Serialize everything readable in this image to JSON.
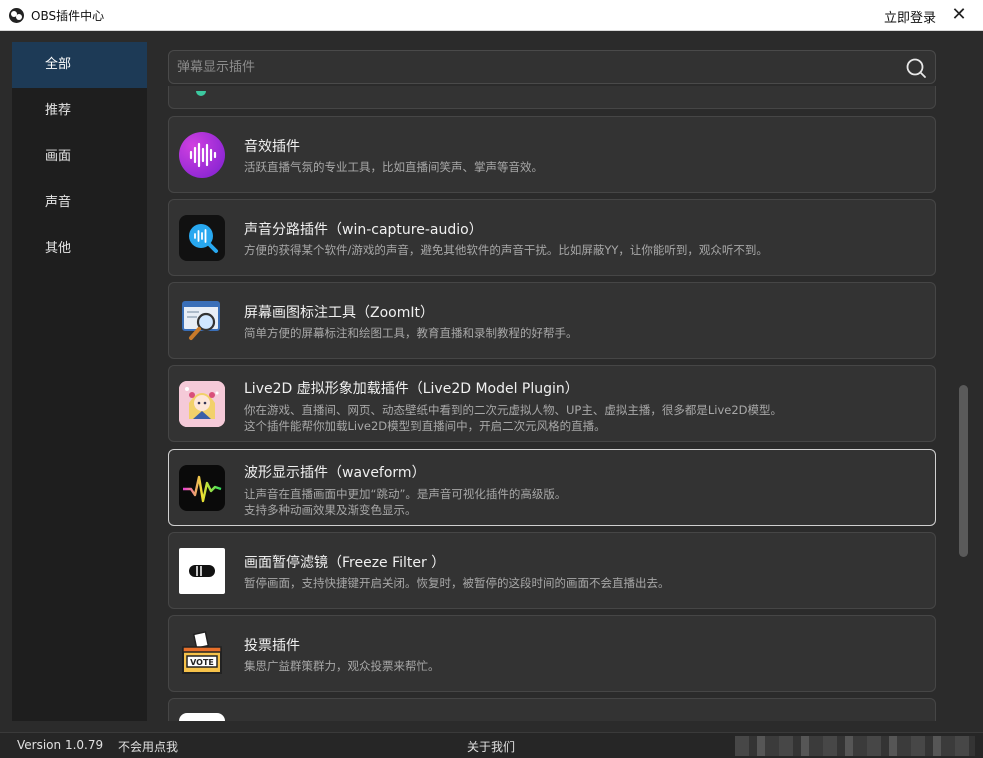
{
  "window": {
    "title": "OBS插件中心",
    "login": "立即登录",
    "close": "✕"
  },
  "sidebar": {
    "items": [
      {
        "label": "全部",
        "active": true
      },
      {
        "label": "推荐"
      },
      {
        "label": "画面"
      },
      {
        "label": "声音"
      },
      {
        "label": "其他"
      }
    ]
  },
  "search": {
    "placeholder": "弹幕显示插件"
  },
  "plugins": [
    {
      "name": "音效插件",
      "desc": [
        "活跃直播气氛的专业工具，比如直播间笑声、掌声等音效。"
      ],
      "icon": "sound-wave-icon"
    },
    {
      "name": "声音分路插件（win-capture-audio）",
      "desc": [
        "方便的获得某个软件/游戏的声音，避免其他软件的声音干扰。比如屏蔽YY，让你能听到，观众听不到。"
      ],
      "icon": "audio-search-icon"
    },
    {
      "name": "屏幕画图标注工具（ZoomIt）",
      "desc": [
        "简单方便的屏幕标注和绘图工具，教育直播和录制教程的好帮手。"
      ],
      "icon": "magnifier-screen-icon"
    },
    {
      "name": "Live2D 虚拟形象加载插件（Live2D Model Plugin）",
      "desc": [
        "你在游戏、直播间、网页、动态壁纸中看到的二次元虚拟人物、UP主、虚拟主播，很多都是Live2D模型。",
        "这个插件能帮你加载Live2D模型到直播间中，开启二次元风格的直播。"
      ],
      "icon": "anime-avatar-icon"
    },
    {
      "name": "波形显示插件（waveform）",
      "desc": [
        "让声音在直播画面中更加“跳动”。是声音可视化插件的高级版。",
        "支持多种动画效果及渐变色显示。"
      ],
      "icon": "waveform-icon",
      "selected": true
    },
    {
      "name": "画面暂停滤镜（Freeze Filter ）",
      "desc": [
        "暂停画面，支持快捷键开启关闭。恢复时，被暂停的这段时间的画面不会直播出去。"
      ],
      "icon": "freeze-filter-icon"
    },
    {
      "name": "投票插件",
      "desc": [
        "集思广益群策群力，观众投票来帮忙。"
      ],
      "icon": "vote-box-icon"
    }
  ],
  "footer": {
    "version": "Version 1.0.79",
    "help": "不会用点我",
    "about": "关于我们"
  },
  "colors": {
    "accent": "#1d3a56",
    "background": "#2b2b2b",
    "card": "#333333"
  }
}
